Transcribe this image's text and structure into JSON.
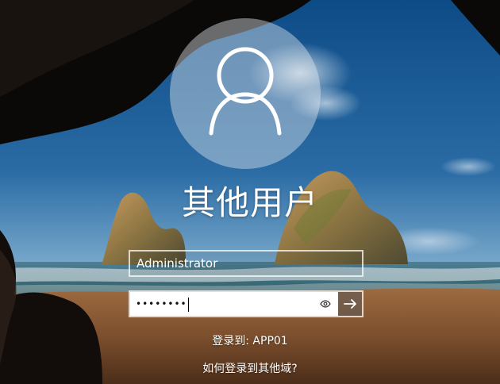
{
  "user": {
    "display_name": "其他用户",
    "avatar_icon": "user-icon"
  },
  "login": {
    "username_value": "Administrator",
    "password_mask": "••••••••",
    "reveal_icon": "eye-icon",
    "submit_icon": "arrow-right-icon"
  },
  "domain": {
    "login_to": "登录到: APP01",
    "help_link": "如何登录到其他域?"
  },
  "colors": {
    "text": "#ffffff",
    "field_bg": "#ffffff"
  }
}
